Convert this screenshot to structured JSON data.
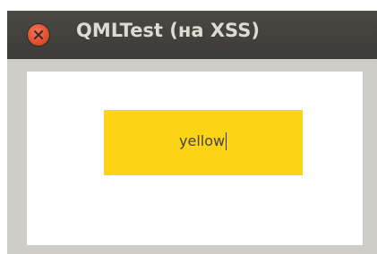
{
  "window": {
    "title": "QMLTest (на XSS)",
    "close_icon": "close-icon"
  },
  "text_field": {
    "value": "yellow",
    "background_color": "#fdd415"
  },
  "colors": {
    "titlebar": "#3c3b37",
    "title_text": "#dfdbd2",
    "close_button": "#e2512f",
    "frame": "#cecdc7",
    "canvas": "#ffffff"
  }
}
